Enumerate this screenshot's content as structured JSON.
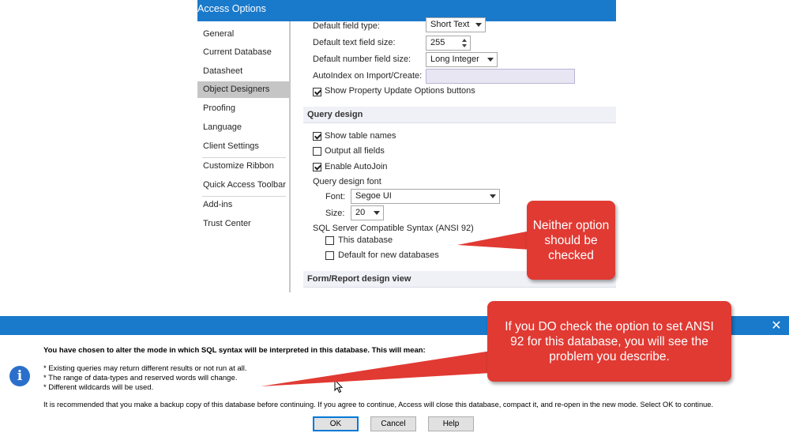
{
  "options_window": {
    "title": "Access Options",
    "nav": [
      {
        "label": "General"
      },
      {
        "label": "Current Database"
      },
      {
        "label": "Datasheet"
      },
      {
        "label": "Object Designers"
      },
      {
        "label": "Proofing"
      },
      {
        "label": "Language"
      },
      {
        "label": "Client Settings"
      },
      {
        "label": "Customize Ribbon"
      },
      {
        "label": "Quick Access Toolbar"
      },
      {
        "label": "Add-ins"
      },
      {
        "label": "Trust Center"
      }
    ],
    "selected_nav": "Object Designers",
    "table_design": {
      "default_field_type_label": "Default field type:",
      "default_field_type_value": "Short Text",
      "default_text_size_label": "Default text field size:",
      "default_text_size_value": "255",
      "default_number_size_label": "Default number field size:",
      "default_number_size_value": "Long Integer",
      "autoindex_label": "AutoIndex on Import/Create:",
      "autoindex_value": "",
      "show_property_update_label": "Show Property Update Options buttons",
      "show_property_update_checked": true
    },
    "query_design": {
      "heading": "Query design",
      "show_table_names_label": "Show table names",
      "show_table_names_checked": true,
      "output_all_fields_label": "Output all fields",
      "output_all_fields_checked": false,
      "enable_autojoin_label": "Enable AutoJoin",
      "enable_autojoin_checked": true,
      "font_group_label": "Query design font",
      "font_label": "Font:",
      "font_value": "Segoe UI",
      "size_label": "Size:",
      "size_value": "20",
      "sql_syntax_label": "SQL Server Compatible Syntax (ANSI 92)",
      "this_database_label": "This database",
      "this_database_checked": false,
      "default_new_db_label": "Default for new databases",
      "default_new_db_checked": false
    },
    "form_report_heading": "Form/Report design view"
  },
  "callouts": {
    "top": "Neither option should be checked",
    "bottom": "If you DO check the option to set ANSI 92 for this database, you will see the problem you describe.",
    "color": "#e03a33"
  },
  "warning_dialog": {
    "close_glyph": "✕",
    "heading": "You have chosen to alter the mode in which SQL syntax will be interpreted in this database. This will mean:",
    "bullets": [
      "* Existing queries may return different results or not run at all.",
      "* The range of data-types and reserved words will change.",
      "* Different wildcards will be used."
    ],
    "recommendation": "It is recommended that you make a backup copy of this database before continuing. If you agree to continue, Access will close this database, compact it, and re-open in the new mode. Select OK to continue.",
    "ok_label": "OK",
    "cancel_label": "Cancel",
    "help_label": "Help",
    "icon_glyph": "i"
  },
  "colors": {
    "titlebar": "#1979ca",
    "accent": "#e03a33"
  }
}
